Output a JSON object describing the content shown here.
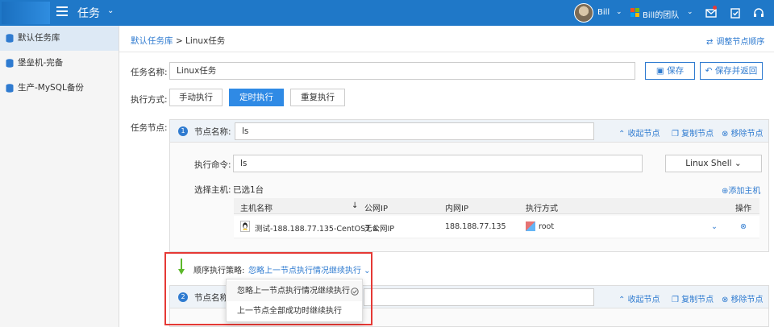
{
  "topbar": {
    "app_title": "任务",
    "user_name": "Bill",
    "team_name": "Bill的团队",
    "brand_color": "#1f78c8"
  },
  "sidebar": {
    "items": [
      {
        "label": "默认任务库"
      },
      {
        "label": "堡垒机-完备"
      },
      {
        "label": "生产-MySQL备份"
      }
    ]
  },
  "breadcrumb": {
    "root": "默认任务库",
    "separator": ">",
    "current": "Linux任务"
  },
  "adjust_order_label": "调整节点顺序",
  "form": {
    "task_name_label": "任务名称:",
    "task_name_value": "Linux任务",
    "save_label": "保存",
    "save_return_label": "保存并返回",
    "exec_mode_label": "执行方式:",
    "exec_modes": [
      "手动执行",
      "定时执行",
      "重复执行"
    ],
    "nodes_label": "任务节点:"
  },
  "node1": {
    "number": "1",
    "name_label": "节点名称:",
    "name_value": "ls",
    "collapse_label": "收起节点",
    "copy_label": "复制节点",
    "remove_label": "移除节点",
    "command_label": "执行命令:",
    "command_value": "ls",
    "shell_select": "Linux Shell",
    "host_label": "选择主机:",
    "host_selected": "已选1台",
    "add_host_label": "添加主机",
    "table_headers": [
      "主机名称",
      "公网IP",
      "内网IP",
      "执行方式",
      "操作"
    ],
    "hosts": [
      {
        "name": "测试-188.188.77.135-CentOS7.4",
        "public_ip": "无公网IP",
        "private_ip": "188.188.77.135",
        "exec_user": "root"
      }
    ]
  },
  "strategy": {
    "label": "顺序执行策略:",
    "selected": "忽略上一节点执行情况继续执行",
    "options": [
      "忽略上一节点执行情况继续执行",
      "上一节点全部成功时继续执行"
    ]
  },
  "node2": {
    "number": "2",
    "name_label": "节点名称",
    "collapse_label": "收起节点",
    "copy_label": "复制节点",
    "remove_label": "移除节点"
  }
}
